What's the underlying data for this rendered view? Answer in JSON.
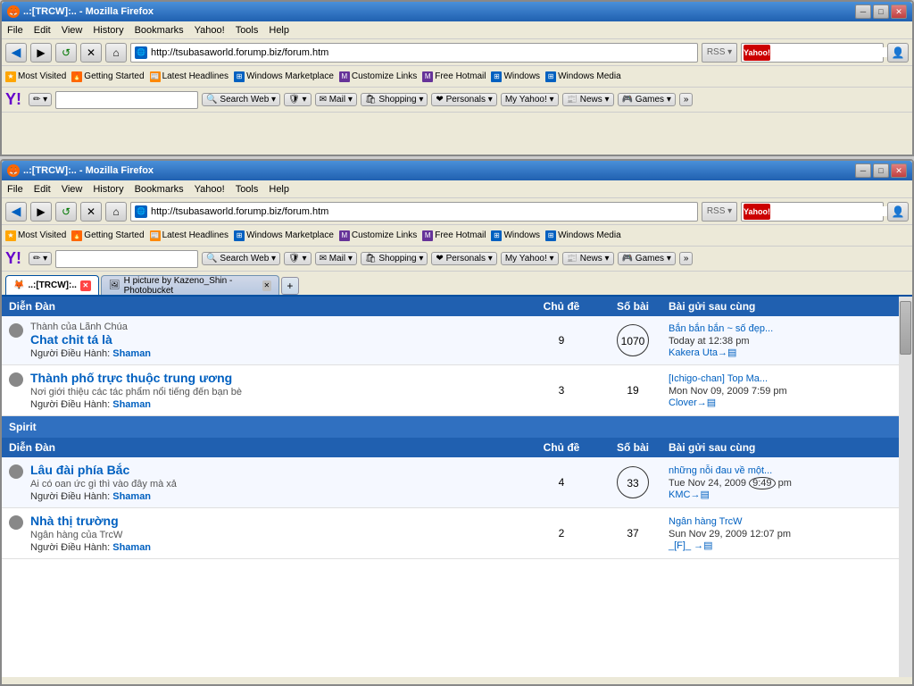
{
  "window1": {
    "title": "..:[TRCW]:.. - Mozilla Firefox",
    "url": "http://tsubasaworld.forump.biz/forum.htm",
    "menu": [
      "File",
      "Edit",
      "View",
      "History",
      "Bookmarks",
      "Yahoo!",
      "Tools",
      "Help"
    ],
    "bookmarks": [
      {
        "label": "Most Visited",
        "icon": "★"
      },
      {
        "label": "Getting Started",
        "icon": "🔥"
      },
      {
        "label": "Latest Headlines",
        "icon": "📰"
      },
      {
        "label": "Windows Marketplace",
        "icon": "⊞"
      },
      {
        "label": "Customize Links",
        "icon": "M"
      },
      {
        "label": "Free Hotmail",
        "icon": "M"
      },
      {
        "label": "Windows",
        "icon": "⊞"
      },
      {
        "label": "Windows Media",
        "icon": "⊞"
      }
    ],
    "yahoo_toolbar": {
      "search_placeholder": "Search Web",
      "buttons": [
        "Mail",
        "Shopping",
        "Personals",
        "My Yahoo!",
        "News",
        "Games"
      ]
    }
  },
  "window2": {
    "title": "..:[TRCW]:.. - Mozilla Firefox",
    "url": "http://tsubasaworld.forump.biz/forum.htm",
    "menu": [
      "File",
      "Edit",
      "View",
      "History",
      "Bookmarks",
      "Yahoo!",
      "Tools",
      "Help"
    ],
    "bookmarks": [
      {
        "label": "Most Visited",
        "icon": "★"
      },
      {
        "label": "Getting Started",
        "icon": "🔥"
      },
      {
        "label": "Latest Headlines",
        "icon": "📰"
      },
      {
        "label": "Windows Marketplace",
        "icon": "⊞"
      },
      {
        "label": "Customize Links",
        "icon": "M"
      },
      {
        "label": "Free Hotmail",
        "icon": "M"
      },
      {
        "label": "Windows",
        "icon": "⊞"
      },
      {
        "label": "Windows Media",
        "icon": "⊞"
      }
    ],
    "yahoo_toolbar": {
      "search_placeholder": "Search Web",
      "buttons": [
        "Mail",
        "Shopping",
        "Personals",
        "My Yahoo!",
        "News",
        "Games"
      ]
    },
    "tabs": [
      {
        "label": "..:[TRCW]:..",
        "active": true
      },
      {
        "label": "H picture by Kazeno_Shin - Photobucket",
        "active": false
      }
    ]
  },
  "forum": {
    "columns": {
      "dien_dan": "Diễn Đàn",
      "chu_de": "Chủ đề",
      "so_bai": "Số bài",
      "bai_gui": "Bài gửi sau cùng"
    },
    "sections": [
      {
        "name": "",
        "rows": [
          {
            "title": "Thành của Lãnh Chúa",
            "subtitle": "Chat chit tá là",
            "desc": "",
            "admin_label": "Người Điều Hành:",
            "admin": "Shaman",
            "chu_de": "9",
            "so_bai_circled": "1070",
            "so_bai_circled_show": true,
            "last_title": "Bắn bắn bắn ~ số đẹp...",
            "last_date": "Today at 12:38 pm",
            "last_user": "Kakera Uta"
          },
          {
            "title": "Thành phố trực thuộc trung ương",
            "subtitle": "Nơi giới thiệu các tác phẩm nổi tiếng đến bạn bè",
            "desc": "",
            "admin_label": "Người Điều Hành:",
            "admin": "Shaman",
            "chu_de": "3",
            "so_bai": "19",
            "so_bai_circled": false,
            "last_title": "[Ichigo-chan] Top Ma...",
            "last_date": "Mon Nov 09, 2009 7:59 pm",
            "last_user": "Clover"
          }
        ]
      },
      {
        "name": "Spirit",
        "rows": [
          {
            "title": "Lâu đài phía Bắc",
            "subtitle": "Ai có oan ức gì thì vào đây mà xả",
            "desc": "",
            "admin_label": "Người Điều Hành:",
            "admin": "Shaman",
            "chu_de": "4",
            "so_bai_circled": "33",
            "so_bai_circled_show": true,
            "last_title": "những nỗi đau về một...",
            "last_date": "Tue Nov 24, 2009 9:49 pm",
            "last_user": "KMC"
          },
          {
            "title": "Nhà thị trường",
            "subtitle": "Ngân hàng của TrcW",
            "desc": "",
            "admin_label": "Người Điều Hành:",
            "admin": "Shaman",
            "chu_de": "2",
            "so_bai": "37",
            "so_bai_circled": false,
            "last_title": "Ngân hàng TrcW",
            "last_date": "Sun Nov 29, 2009 12:07 pm",
            "last_user": "_[F]_"
          }
        ]
      }
    ]
  }
}
